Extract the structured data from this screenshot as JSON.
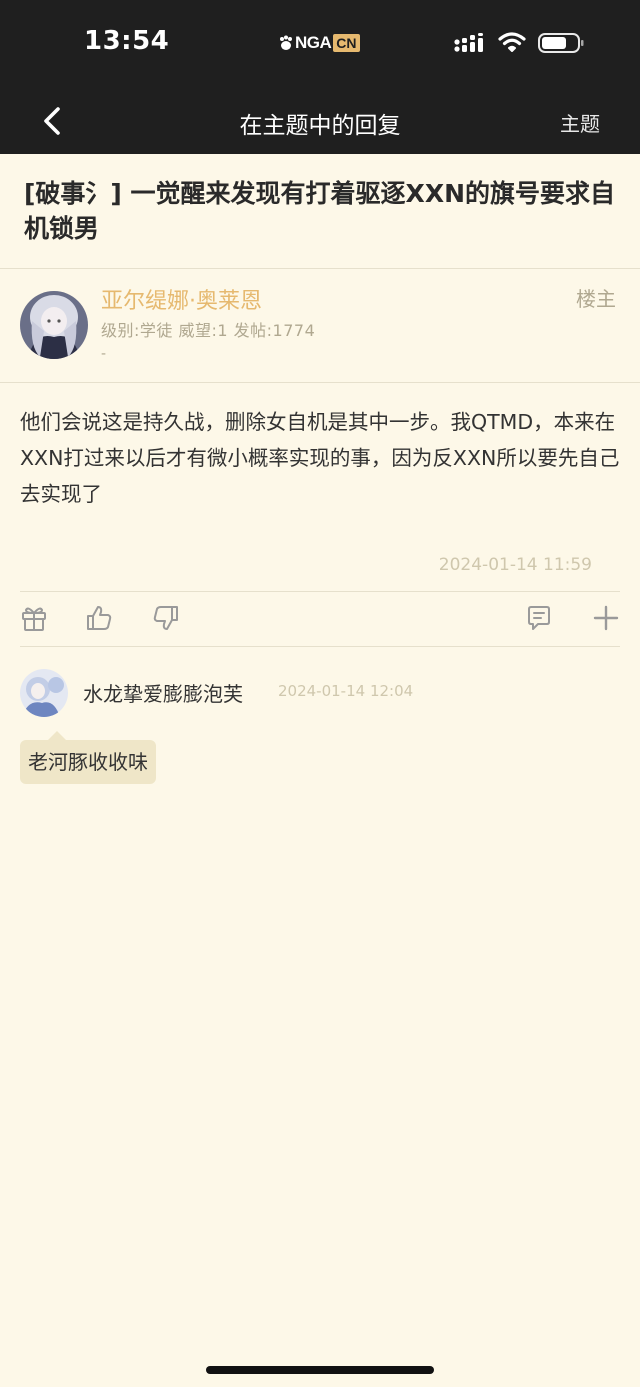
{
  "status": {
    "time": "13:54",
    "logo_main": "NGA",
    "logo_suffix": "CN"
  },
  "nav": {
    "title": "在主题中的回复",
    "right_label": "主题"
  },
  "thread": {
    "title": "[破事氵] 一觉醒来发现有打着驱逐XXN的旗号要求自机锁男"
  },
  "post": {
    "author": "亚尔缇娜·奥莱恩",
    "floor_label": "楼主",
    "meta": "级别:学徒  威望:1  发帖:1774",
    "signature": "-",
    "content": "他们会说这是持久战，删除女自机是其中一步。我QTMD，本来在XXN打过来以后才有微小概率实现的事，因为反XXN所以要先自己去实现了",
    "time": "2024-01-14 11:59"
  },
  "actions": [
    {
      "name": "gift-icon"
    },
    {
      "name": "like-icon"
    },
    {
      "name": "dislike-icon"
    },
    {
      "name": "comment-icon"
    },
    {
      "name": "plus-icon"
    }
  ],
  "comment": {
    "user": "水龙挚爱膨膨泡芙",
    "time": "2024-01-14 12:04",
    "text": "老河豚收收味"
  },
  "colors": {
    "topbar": "#1f1f1f",
    "background": "#fdf8e8",
    "accent": "#e6b96f",
    "bubble": "#efe6c8"
  }
}
